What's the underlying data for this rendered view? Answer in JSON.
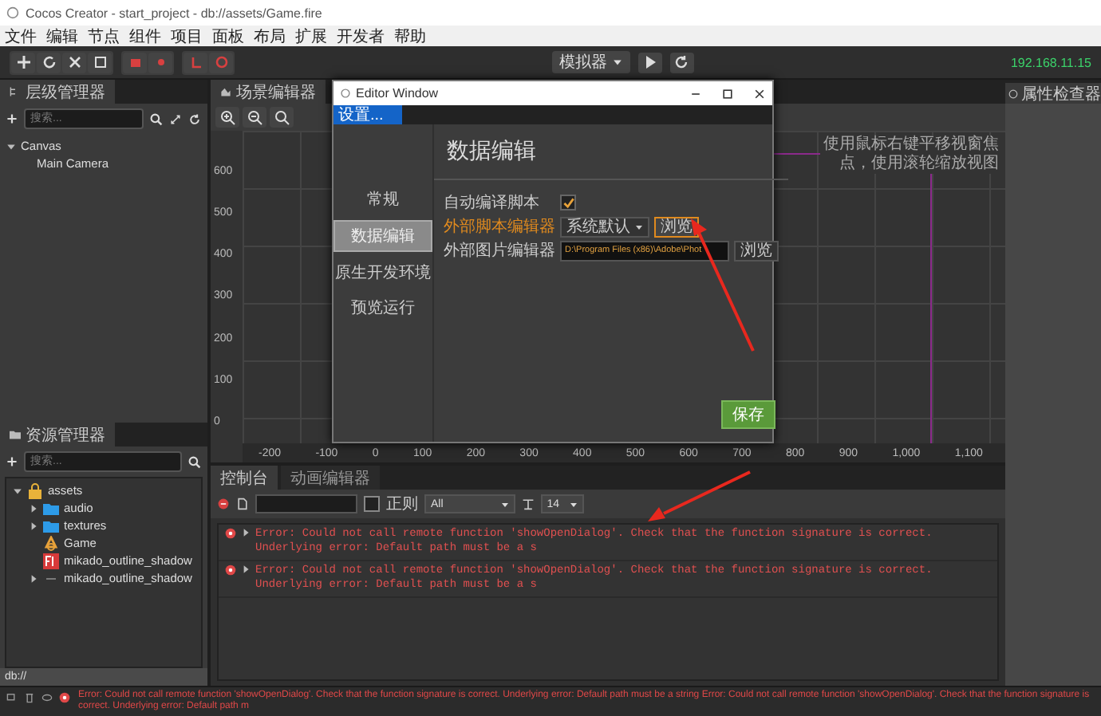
{
  "window": {
    "title": "Cocos Creator - start_project - db://assets/Game.fire"
  },
  "menu": [
    "文件",
    "编辑",
    "节点",
    "组件",
    "项目",
    "面板",
    "布局",
    "扩展",
    "开发者",
    "帮助"
  ],
  "toolbar": {
    "simulator": "模拟器",
    "ip": "192.168.11.15"
  },
  "hierarchy": {
    "title": "层级管理器",
    "search_placeholder": "搜索...",
    "tree": [
      {
        "label": "Canvas",
        "expanded": true,
        "children": [
          {
            "label": "Main Camera"
          }
        ]
      }
    ]
  },
  "assets": {
    "title": "资源管理器",
    "search_placeholder": "搜索...",
    "path": "db://",
    "tree": [
      {
        "label": "assets",
        "kind": "root",
        "expanded": true,
        "children": [
          {
            "label": "audio",
            "kind": "folder",
            "expanded": false
          },
          {
            "label": "textures",
            "kind": "folder",
            "expanded": false
          },
          {
            "label": "Game",
            "kind": "scene"
          },
          {
            "label": "mikado_outline_shadow",
            "kind": "font"
          },
          {
            "label": "mikado_outline_shadow",
            "kind": "bitmap-font",
            "expanded": false
          }
        ]
      }
    ]
  },
  "scene": {
    "title": "场景编辑器",
    "hint": "使用鼠标右键平移视窗焦点，使用滚轮缩放视图",
    "y_ruler": [
      "600",
      "500",
      "400",
      "300",
      "200",
      "100",
      "0"
    ],
    "x_ruler": [
      "-200",
      "-100",
      "0",
      "100",
      "200",
      "300",
      "400",
      "500",
      "600",
      "700",
      "800",
      "900",
      "1,000",
      "1,100"
    ]
  },
  "console": {
    "tabs": [
      {
        "label": "控制台",
        "selected": true
      },
      {
        "label": "动画编辑器",
        "selected": false
      }
    ],
    "regex": {
      "label": "正则",
      "checked": false
    },
    "filter": "All",
    "font_size": "14",
    "messages": [
      {
        "kind": "error",
        "text": "Error: Could not call remote function 'showOpenDialog'. Check that the function signature is correct. Underlying error: Default path must be a s"
      },
      {
        "kind": "error",
        "text": "Error: Could not call remote function 'showOpenDialog'. Check that the function signature is correct. Underlying error: Default path must be a s"
      }
    ]
  },
  "inspector": {
    "title": "属性检查器"
  },
  "status_bar": {
    "kind": "error",
    "text": "Error: Could not call remote function 'showOpenDialog'. Check that the function signature is correct. Underlying error: Default path must be a string Error: Could not call remote function 'showOpenDialog'. Check that the function signature is correct. Underlying error: Default path m"
  },
  "editor_window": {
    "title": "Editor Window",
    "tab": "设置...",
    "heading": "数据编辑",
    "save": "保存",
    "nav": [
      {
        "label": "常规",
        "selected": false
      },
      {
        "label": "数据编辑",
        "selected": true
      },
      {
        "label": "原生开发环境",
        "selected": false
      },
      {
        "label": "预览运行",
        "selected": false
      }
    ],
    "settings": [
      {
        "kind": "checkbox",
        "label": "自动编译脚本",
        "checked": true,
        "highlighted": false
      },
      {
        "kind": "select",
        "label": "外部脚本编辑器",
        "value": "系统默认",
        "button": "浏览",
        "highlighted": true
      },
      {
        "kind": "path",
        "label": "外部图片编辑器",
        "value": "D:\\Program Files (x86)\\Adobe\\Phot",
        "button": "浏览",
        "highlighted": false
      }
    ]
  }
}
